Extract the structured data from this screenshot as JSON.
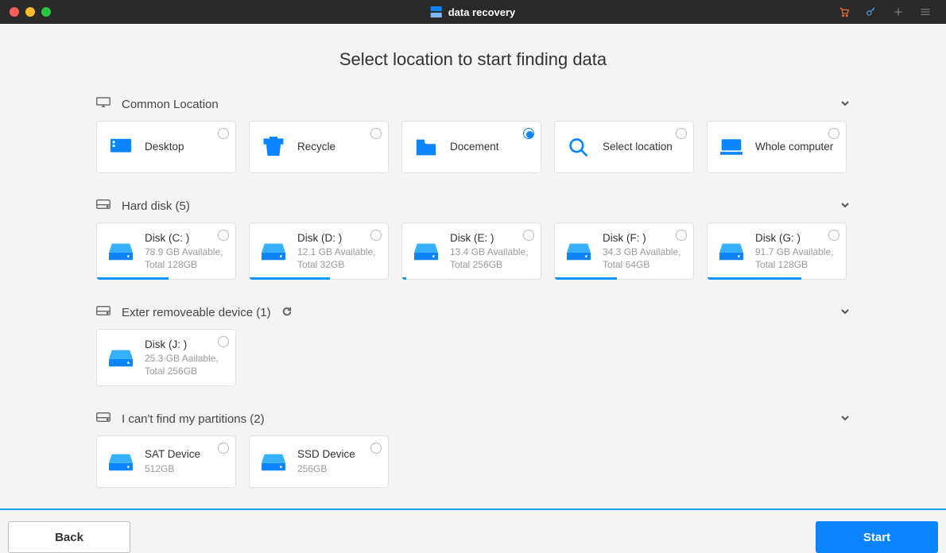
{
  "colors": {
    "accent": "#0a84ff",
    "titlebar": "#2a2a2a",
    "traffic": [
      "#ff5f56",
      "#ffbd2e",
      "#27c93f"
    ]
  },
  "titlebar": {
    "app_name": "data recovery"
  },
  "page": {
    "title": "Select location to  start finding data"
  },
  "sections": {
    "common": {
      "label": "Common Location"
    },
    "hard": {
      "label": "Hard disk (5)"
    },
    "external": {
      "label": "Exter removeable device (1)"
    },
    "lost": {
      "label": "I can't find my partitions (2)"
    }
  },
  "common_items": [
    {
      "label": "Desktop",
      "selected": false
    },
    {
      "label": "Recycle",
      "selected": false
    },
    {
      "label": "Docement",
      "selected": true
    },
    {
      "label": "Select location",
      "selected": false
    },
    {
      "label": "Whole computer",
      "selected": false
    }
  ],
  "hard_disks": [
    {
      "name": "Disk (C: )",
      "sub": "78.9 GB Available, Total 128GB",
      "used_pct": 52
    },
    {
      "name": "Disk (D: )",
      "sub": "12.1 GB Available, Total 32GB",
      "used_pct": 58
    },
    {
      "name": "Disk (E: )",
      "sub": "13.4 GB Available, Total 256GB",
      "used_pct": 3
    },
    {
      "name": "Disk (F: )",
      "sub": "34.3 GB Available, Total 64GB",
      "used_pct": 45
    },
    {
      "name": "Disk (G: )",
      "sub": "91.7 GB Available, Total 128GB",
      "used_pct": 68
    }
  ],
  "external_devices": [
    {
      "name": "Disk (J: )",
      "sub": "25.3 GB Aailable, Total 256GB"
    }
  ],
  "lost_partitions": [
    {
      "name": "SAT Device",
      "sub": "512GB"
    },
    {
      "name": "SSD Device",
      "sub": "256GB"
    }
  ],
  "footer": {
    "back": "Back",
    "start": "Start"
  }
}
